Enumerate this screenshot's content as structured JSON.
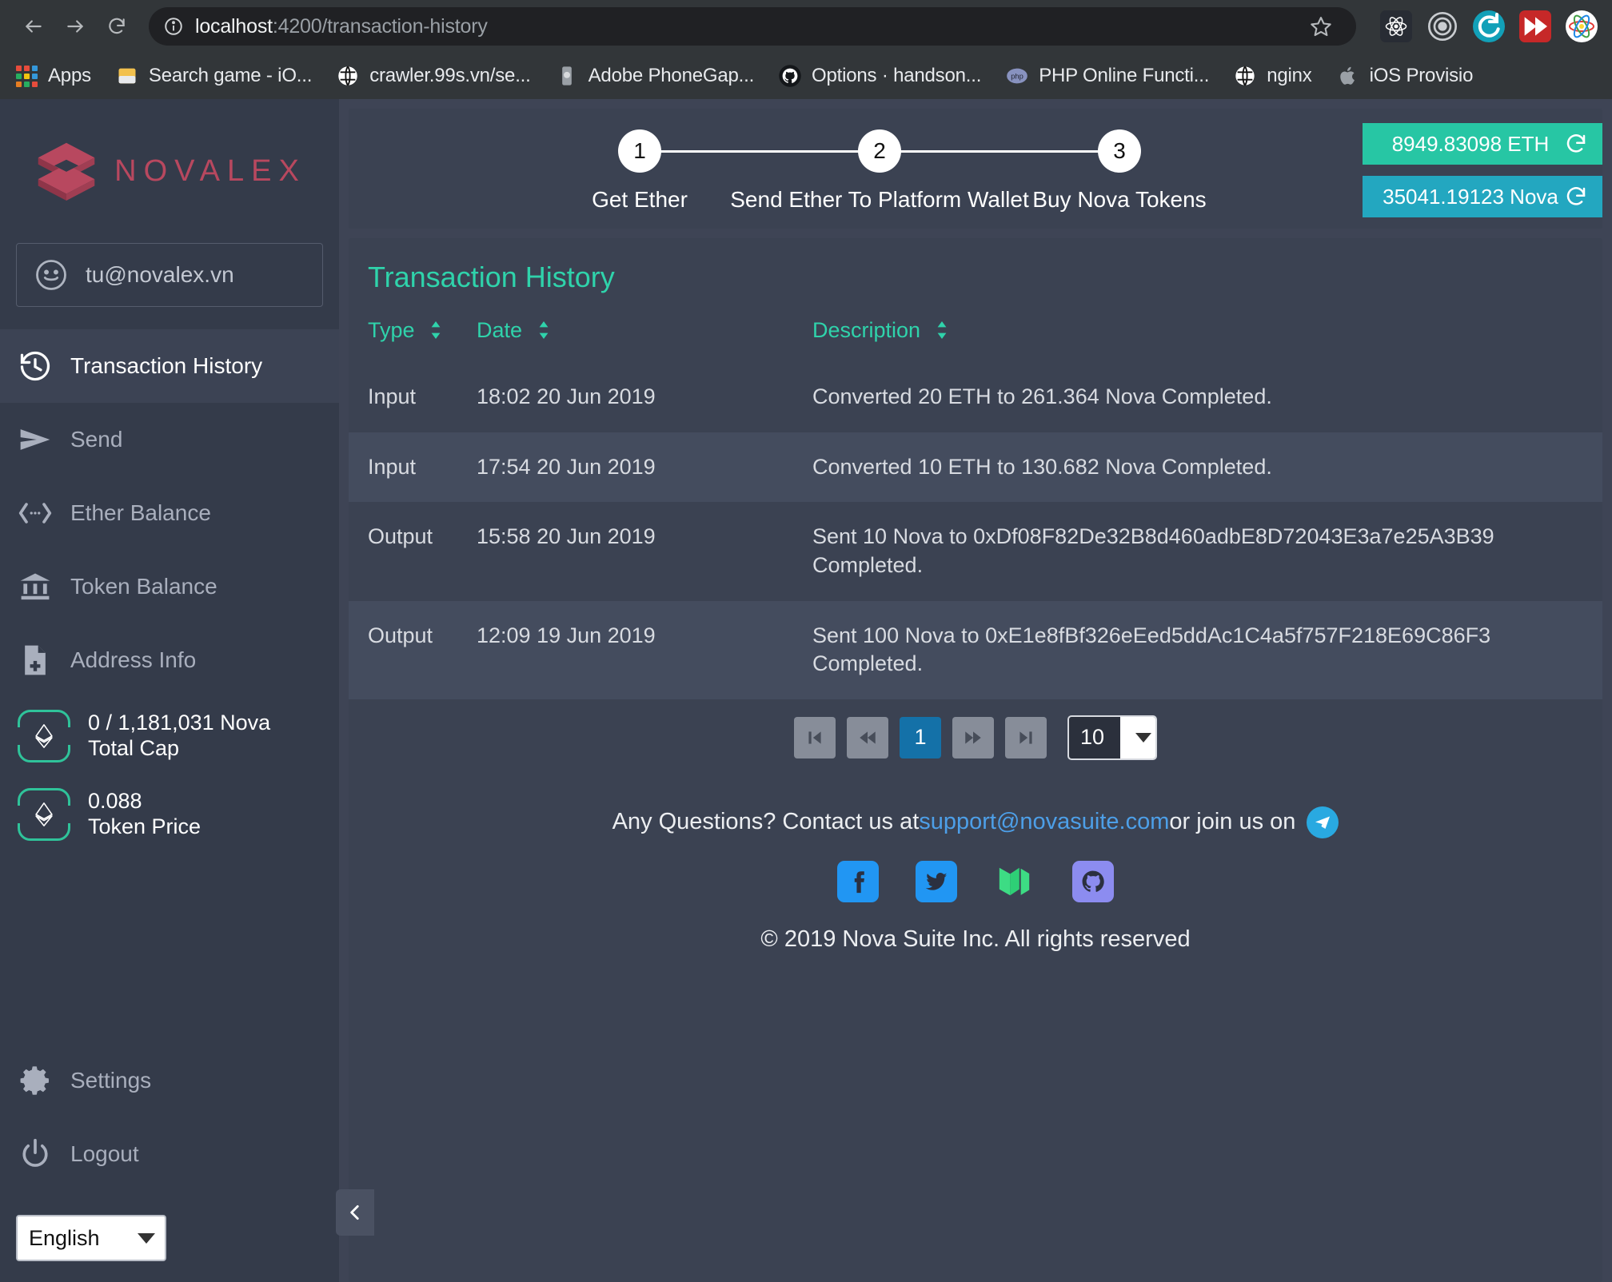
{
  "browser": {
    "url_host": "localhost",
    "url_path": ":4200/transaction-history",
    "back_label": "Back",
    "forward_label": "Forward",
    "reload_label": "Reload",
    "bookmark_star_label": "Bookmark this page",
    "extensions": [
      {
        "name": "react-devtools-icon",
        "label": "React DevTools"
      },
      {
        "name": "target-icon",
        "label": "Recorder"
      },
      {
        "name": "teal-refresh-icon",
        "label": "Sync"
      },
      {
        "name": "red-forward-icon",
        "label": "Fast Forward"
      },
      {
        "name": "atom-icon",
        "label": "Atom"
      }
    ],
    "bookmarks": [
      {
        "label": "Apps",
        "icon": "apps-grid-icon"
      },
      {
        "label": "Search game - iO...",
        "icon": "mail-icon"
      },
      {
        "label": "crawler.99s.vn/se...",
        "icon": "globe-icon"
      },
      {
        "label": "Adobe PhoneGap...",
        "icon": "phonegap-icon"
      },
      {
        "label": "Options · handson...",
        "icon": "github-icon"
      },
      {
        "label": "PHP Online Functi...",
        "icon": "php-icon"
      },
      {
        "label": "nginx",
        "icon": "globe-icon"
      },
      {
        "label": "iOS Provisio",
        "icon": "apple-icon"
      }
    ]
  },
  "sidebar": {
    "brand": "NOVALEX",
    "account_email": "tu@novalex.vn",
    "nav": [
      {
        "label": "Transaction History",
        "icon": "history-icon",
        "active": true
      },
      {
        "label": "Send",
        "icon": "send-icon",
        "active": false
      },
      {
        "label": "Ether Balance",
        "icon": "ether-balance-icon",
        "active": false
      },
      {
        "label": "Token Balance",
        "icon": "bank-icon",
        "active": false
      },
      {
        "label": "Address Info",
        "icon": "document-plus-icon",
        "active": false
      }
    ],
    "stats": [
      {
        "value": "0 / 1,181,031 Nova",
        "label": "Total Cap",
        "icon": "ethereum-icon"
      },
      {
        "value": "0.088",
        "label": "Token Price",
        "icon": "ethereum-icon"
      }
    ],
    "bottom_nav": [
      {
        "label": "Settings",
        "icon": "gear-icon"
      },
      {
        "label": "Logout",
        "icon": "power-icon"
      }
    ],
    "language": "English",
    "collapse_label": "Collapse sidebar",
    "accent_brand": "#b8485f",
    "accent_green": "#2fc39a"
  },
  "topbar": {
    "steps": [
      {
        "number": "1",
        "label": "Get Ether"
      },
      {
        "number": "2",
        "label": "Send Ether To Platform Wallet"
      },
      {
        "number": "3",
        "label": "Buy Nova Tokens"
      }
    ],
    "balances": [
      {
        "value": "8949.83098 ETH",
        "color": "#27c6a4",
        "refresh_label": "Refresh ETH balance"
      },
      {
        "value": "35041.19123 Nova",
        "color": "#23a7c0",
        "refresh_label": "Refresh Nova balance"
      }
    ]
  },
  "panel": {
    "title": "Transaction History",
    "accent": "#2fd3ab",
    "columns": [
      {
        "label": "Type",
        "sortable": true
      },
      {
        "label": "Date",
        "sortable": true
      },
      {
        "label": "Description",
        "sortable": true
      }
    ],
    "rows": [
      {
        "type": "Input",
        "date": "18:02 20 Jun 2019",
        "description": "Converted 20 ETH to 261.364 Nova Completed."
      },
      {
        "type": "Input",
        "date": "17:54 20 Jun 2019",
        "description": "Converted 10 ETH to 130.682 Nova Completed."
      },
      {
        "type": "Output",
        "date": "15:58 20 Jun 2019",
        "description": "Sent 10 Nova to 0xDf08F82De32B8d460adbE8D72043E3a7e25A3B39 Completed."
      },
      {
        "type": "Output",
        "date": "12:09 19 Jun 2019",
        "description": "Sent 100 Nova to 0xE1e8fBf326eEed5ddAc1C4a5f757F218E69C86F3 Completed."
      }
    ],
    "pagination": {
      "first_label": "First page",
      "prev_label": "Previous page",
      "current_page": "1",
      "next_label": "Next page",
      "last_label": "Last page",
      "page_size": "10"
    }
  },
  "footer": {
    "question_text": "Any Questions? Contact us at ",
    "email": "support@novasuite.com",
    "join_text": " or join us on ",
    "telegram_label": "Telegram",
    "socials": [
      {
        "name": "facebook-icon",
        "color": "#2196f3"
      },
      {
        "name": "twitter-icon",
        "color": "#2196f3"
      },
      {
        "name": "medium-icon",
        "color": "#3ddc84"
      },
      {
        "name": "github-icon",
        "color": "#8c8cf0"
      }
    ],
    "copyright": "© 2019 Nova Suite Inc. All rights reserved"
  }
}
